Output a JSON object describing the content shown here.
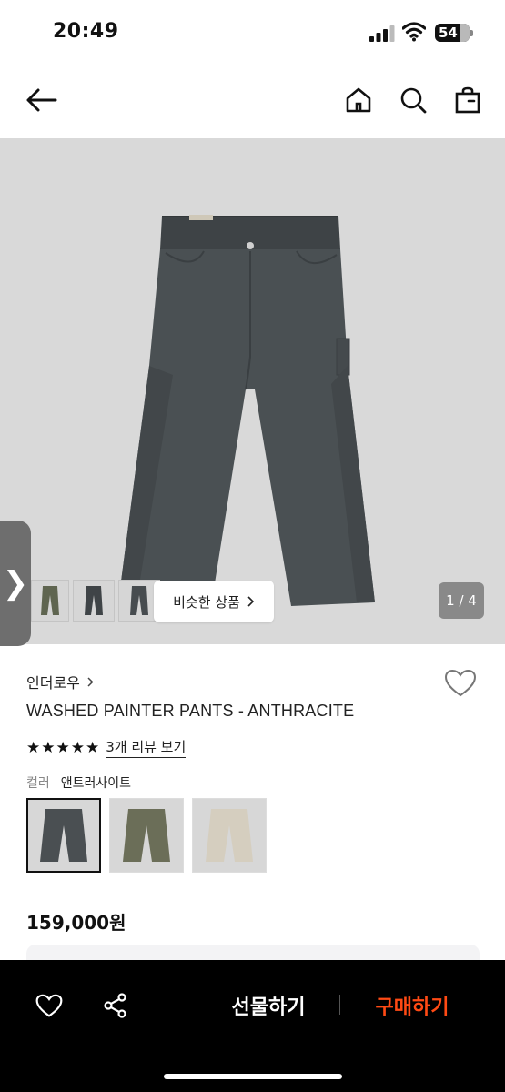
{
  "status": {
    "time": "20:49",
    "battery": "54"
  },
  "nav": {
    "icons": [
      "back-arrow-icon",
      "home-icon",
      "search-icon",
      "shopping-bag-icon"
    ]
  },
  "gallery": {
    "similar_label": "비슷한 상품",
    "page_indicator": "1 / 4",
    "handle_glyph": "❯"
  },
  "product": {
    "brand": "인더로우",
    "title": "WASHED PAINTER PANTS - ANTHRACITE",
    "rating_stars": 5,
    "review_link": "3개 리뷰 보기",
    "color_label": "컬러",
    "color_value": "앤트러사이트",
    "swatch_colors": [
      "#4a4f52",
      "#6b6e58",
      "#d5cebf"
    ],
    "price": "159,000원"
  },
  "bottom_bar": {
    "gift_label": "선물하기",
    "buy_label": "구매하기",
    "buy_color": "#ff4a14"
  }
}
